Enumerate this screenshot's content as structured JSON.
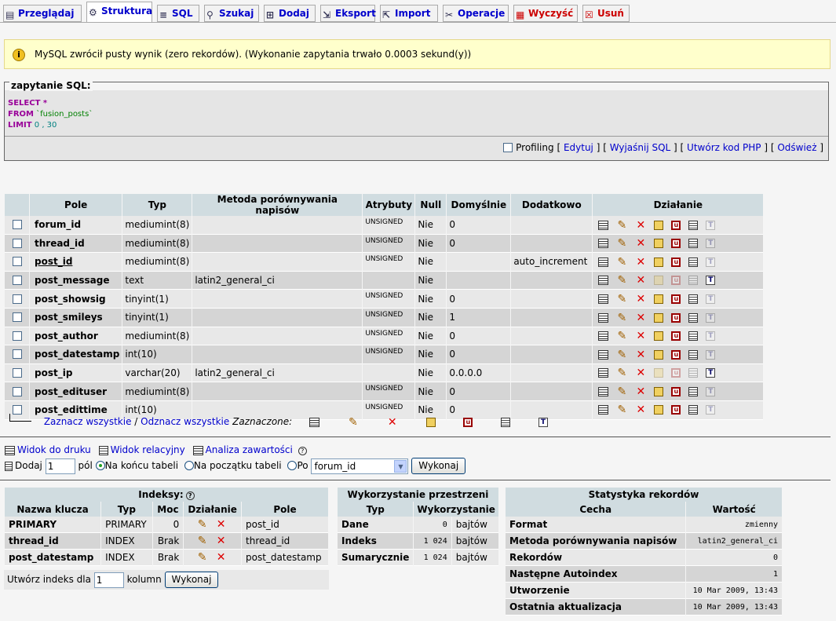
{
  "tabs": [
    {
      "label": "Przeglądaj",
      "icon": "browse-icon",
      "active": false
    },
    {
      "label": "Struktura",
      "icon": "structure-icon",
      "active": true
    },
    {
      "label": "SQL",
      "icon": "sql-icon",
      "active": false
    },
    {
      "label": "Szukaj",
      "icon": "search-icon",
      "active": false
    },
    {
      "label": "Dodaj",
      "icon": "insert-icon",
      "active": false
    },
    {
      "label": "Eksport",
      "icon": "export-icon",
      "active": false
    },
    {
      "label": "Import",
      "icon": "import-icon",
      "active": false
    },
    {
      "label": "Operacje",
      "icon": "operations-icon",
      "active": false
    },
    {
      "label": "Wyczyść",
      "icon": "empty-icon",
      "active": false,
      "danger": true
    },
    {
      "label": "Usuń",
      "icon": "drop-icon",
      "active": false,
      "danger": true
    }
  ],
  "notice": {
    "icon": "info-icon",
    "text": "MySQL zwrócił pusty wynik (zero rekordów). (Wykonanie zapytania trwało 0.0003 sekund(y))"
  },
  "sql": {
    "legend": "zapytanie SQL:",
    "line1_kw": "SELECT",
    "line1_rest": " *",
    "line2_kw": "FROM",
    "line2_rest": " `fusion_posts`",
    "line3_kw": "LIMIT",
    "line3_rest": " 0 , 30",
    "profiling": "Profiling",
    "edit": "Edytuj",
    "explain": "Wyjaśnij SQL",
    "php": "Utwórz kod PHP",
    "refresh": "Odśwież"
  },
  "table": {
    "headers": [
      "Pole",
      "Typ",
      "Metoda porównywania napisów",
      "Atrybuty",
      "Null",
      "Domyślnie",
      "Dodatkowo",
      "Działanie"
    ],
    "rows": [
      {
        "field": "forum_id",
        "type": "mediumint(8)",
        "collation": "",
        "attr": "UNSIGNED",
        "null": "Nie",
        "default": "0",
        "extra": "",
        "primary": false,
        "fulltext": false
      },
      {
        "field": "thread_id",
        "type": "mediumint(8)",
        "collation": "",
        "attr": "UNSIGNED",
        "null": "Nie",
        "default": "0",
        "extra": "",
        "primary": false,
        "fulltext": false
      },
      {
        "field": "post_id",
        "type": "mediumint(8)",
        "collation": "",
        "attr": "UNSIGNED",
        "null": "Nie",
        "default": "",
        "extra": "auto_increment",
        "primary": true,
        "fulltext": false
      },
      {
        "field": "post_message",
        "type": "text",
        "collation": "latin2_general_ci",
        "attr": "",
        "null": "Nie",
        "default": "",
        "extra": "",
        "primary": false,
        "fulltext": true
      },
      {
        "field": "post_showsig",
        "type": "tinyint(1)",
        "collation": "",
        "attr": "UNSIGNED",
        "null": "Nie",
        "default": "0",
        "extra": "",
        "primary": false,
        "fulltext": false
      },
      {
        "field": "post_smileys",
        "type": "tinyint(1)",
        "collation": "",
        "attr": "UNSIGNED",
        "null": "Nie",
        "default": "1",
        "extra": "",
        "primary": false,
        "fulltext": false
      },
      {
        "field": "post_author",
        "type": "mediumint(8)",
        "collation": "",
        "attr": "UNSIGNED",
        "null": "Nie",
        "default": "0",
        "extra": "",
        "primary": false,
        "fulltext": false
      },
      {
        "field": "post_datestamp",
        "type": "int(10)",
        "collation": "",
        "attr": "UNSIGNED",
        "null": "Nie",
        "default": "0",
        "extra": "",
        "primary": false,
        "fulltext": false
      },
      {
        "field": "post_ip",
        "type": "varchar(20)",
        "collation": "latin2_general_ci",
        "attr": "",
        "null": "Nie",
        "default": "0.0.0.0",
        "extra": "",
        "primary": false,
        "fulltext": true
      },
      {
        "field": "post_edituser",
        "type": "mediumint(8)",
        "collation": "",
        "attr": "UNSIGNED",
        "null": "Nie",
        "default": "0",
        "extra": "",
        "primary": false,
        "fulltext": false
      },
      {
        "field": "post_edittime",
        "type": "int(10)",
        "collation": "",
        "attr": "UNSIGNED",
        "null": "Nie",
        "default": "0",
        "extra": "",
        "primary": false,
        "fulltext": false
      }
    ]
  },
  "selection": {
    "check_all": "Zaznacz wszystkie",
    "sep": " / ",
    "uncheck_all": "Odznacz wszystkie",
    "with_selected": "Zaznaczone:"
  },
  "links": {
    "print": "Widok do druku",
    "relational": "Widok relacyjny",
    "propose": "Analiza zawartości"
  },
  "add": {
    "label": "Dodaj",
    "count": "1",
    "fields": "pól",
    "at_end": "Na końcu tabeli",
    "at_begin": "Na początku tabeli",
    "after": "Po",
    "after_field": "forum_id",
    "go": "Wykonaj"
  },
  "indexes": {
    "title": "Indeksy:",
    "headers": [
      "Nazwa klucza",
      "Typ",
      "Moc",
      "Działanie",
      "Pole"
    ],
    "rows": [
      {
        "name": "PRIMARY",
        "type": "PRIMARY",
        "card": "0",
        "field": "post_id"
      },
      {
        "name": "thread_id",
        "type": "INDEX",
        "card": "Brak",
        "field": "thread_id"
      },
      {
        "name": "post_datestamp",
        "type": "INDEX",
        "card": "Brak",
        "field": "post_datestamp"
      }
    ],
    "create_label": "Utwórz indeks dla",
    "create_count": "1",
    "columns": "kolumn",
    "go": "Wykonaj"
  },
  "space": {
    "title": "Wykorzystanie przestrzeni",
    "headers": [
      "Typ",
      "Wykorzystanie"
    ],
    "rows": [
      {
        "label": "Dane",
        "value": "0",
        "unit": "bajtów"
      },
      {
        "label": "Indeks",
        "value": "1 024",
        "unit": "bajtów"
      },
      {
        "label": "Sumarycznie",
        "value": "1 024",
        "unit": "bajtów"
      }
    ]
  },
  "stats": {
    "title": "Statystyka rekordów",
    "headers": [
      "Cecha",
      "Wartość"
    ],
    "rows": [
      {
        "label": "Format",
        "value": "zmienny"
      },
      {
        "label": "Metoda porównywania napisów",
        "value": "latin2_general_ci"
      },
      {
        "label": "Rekordów",
        "value": "0"
      },
      {
        "label": "Następne Autoindex",
        "value": "1"
      },
      {
        "label": "Utworzenie",
        "value": "10 Mar 2009, 13:43"
      },
      {
        "label": "Ostatnia aktualizacja",
        "value": "10 Mar 2009, 13:43"
      }
    ]
  }
}
